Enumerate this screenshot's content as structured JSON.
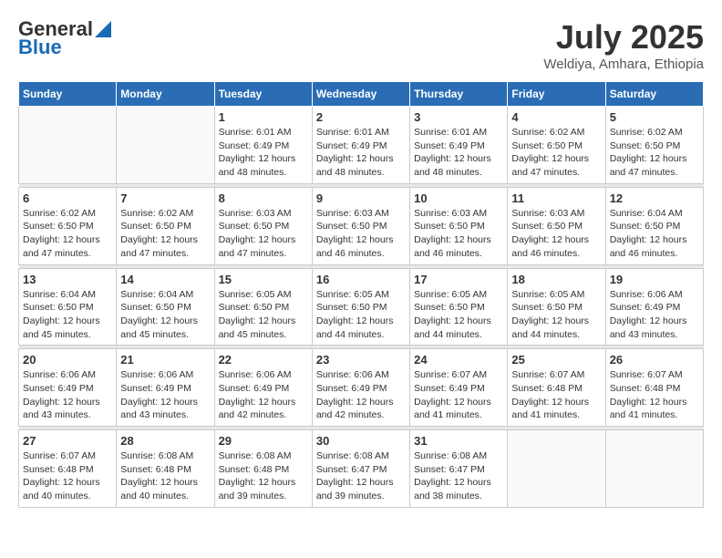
{
  "logo": {
    "general": "General",
    "blue": "Blue"
  },
  "title": "July 2025",
  "location": "Weldiya, Amhara, Ethiopia",
  "days_of_week": [
    "Sunday",
    "Monday",
    "Tuesday",
    "Wednesday",
    "Thursday",
    "Friday",
    "Saturday"
  ],
  "weeks": [
    [
      {
        "day": "",
        "info": ""
      },
      {
        "day": "",
        "info": ""
      },
      {
        "day": "1",
        "info": "Sunrise: 6:01 AM\nSunset: 6:49 PM\nDaylight: 12 hours and 48 minutes."
      },
      {
        "day": "2",
        "info": "Sunrise: 6:01 AM\nSunset: 6:49 PM\nDaylight: 12 hours and 48 minutes."
      },
      {
        "day": "3",
        "info": "Sunrise: 6:01 AM\nSunset: 6:49 PM\nDaylight: 12 hours and 48 minutes."
      },
      {
        "day": "4",
        "info": "Sunrise: 6:02 AM\nSunset: 6:50 PM\nDaylight: 12 hours and 47 minutes."
      },
      {
        "day": "5",
        "info": "Sunrise: 6:02 AM\nSunset: 6:50 PM\nDaylight: 12 hours and 47 minutes."
      }
    ],
    [
      {
        "day": "6",
        "info": "Sunrise: 6:02 AM\nSunset: 6:50 PM\nDaylight: 12 hours and 47 minutes."
      },
      {
        "day": "7",
        "info": "Sunrise: 6:02 AM\nSunset: 6:50 PM\nDaylight: 12 hours and 47 minutes."
      },
      {
        "day": "8",
        "info": "Sunrise: 6:03 AM\nSunset: 6:50 PM\nDaylight: 12 hours and 47 minutes."
      },
      {
        "day": "9",
        "info": "Sunrise: 6:03 AM\nSunset: 6:50 PM\nDaylight: 12 hours and 46 minutes."
      },
      {
        "day": "10",
        "info": "Sunrise: 6:03 AM\nSunset: 6:50 PM\nDaylight: 12 hours and 46 minutes."
      },
      {
        "day": "11",
        "info": "Sunrise: 6:03 AM\nSunset: 6:50 PM\nDaylight: 12 hours and 46 minutes."
      },
      {
        "day": "12",
        "info": "Sunrise: 6:04 AM\nSunset: 6:50 PM\nDaylight: 12 hours and 46 minutes."
      }
    ],
    [
      {
        "day": "13",
        "info": "Sunrise: 6:04 AM\nSunset: 6:50 PM\nDaylight: 12 hours and 45 minutes."
      },
      {
        "day": "14",
        "info": "Sunrise: 6:04 AM\nSunset: 6:50 PM\nDaylight: 12 hours and 45 minutes."
      },
      {
        "day": "15",
        "info": "Sunrise: 6:05 AM\nSunset: 6:50 PM\nDaylight: 12 hours and 45 minutes."
      },
      {
        "day": "16",
        "info": "Sunrise: 6:05 AM\nSunset: 6:50 PM\nDaylight: 12 hours and 44 minutes."
      },
      {
        "day": "17",
        "info": "Sunrise: 6:05 AM\nSunset: 6:50 PM\nDaylight: 12 hours and 44 minutes."
      },
      {
        "day": "18",
        "info": "Sunrise: 6:05 AM\nSunset: 6:50 PM\nDaylight: 12 hours and 44 minutes."
      },
      {
        "day": "19",
        "info": "Sunrise: 6:06 AM\nSunset: 6:49 PM\nDaylight: 12 hours and 43 minutes."
      }
    ],
    [
      {
        "day": "20",
        "info": "Sunrise: 6:06 AM\nSunset: 6:49 PM\nDaylight: 12 hours and 43 minutes."
      },
      {
        "day": "21",
        "info": "Sunrise: 6:06 AM\nSunset: 6:49 PM\nDaylight: 12 hours and 43 minutes."
      },
      {
        "day": "22",
        "info": "Sunrise: 6:06 AM\nSunset: 6:49 PM\nDaylight: 12 hours and 42 minutes."
      },
      {
        "day": "23",
        "info": "Sunrise: 6:06 AM\nSunset: 6:49 PM\nDaylight: 12 hours and 42 minutes."
      },
      {
        "day": "24",
        "info": "Sunrise: 6:07 AM\nSunset: 6:49 PM\nDaylight: 12 hours and 41 minutes."
      },
      {
        "day": "25",
        "info": "Sunrise: 6:07 AM\nSunset: 6:48 PM\nDaylight: 12 hours and 41 minutes."
      },
      {
        "day": "26",
        "info": "Sunrise: 6:07 AM\nSunset: 6:48 PM\nDaylight: 12 hours and 41 minutes."
      }
    ],
    [
      {
        "day": "27",
        "info": "Sunrise: 6:07 AM\nSunset: 6:48 PM\nDaylight: 12 hours and 40 minutes."
      },
      {
        "day": "28",
        "info": "Sunrise: 6:08 AM\nSunset: 6:48 PM\nDaylight: 12 hours and 40 minutes."
      },
      {
        "day": "29",
        "info": "Sunrise: 6:08 AM\nSunset: 6:48 PM\nDaylight: 12 hours and 39 minutes."
      },
      {
        "day": "30",
        "info": "Sunrise: 6:08 AM\nSunset: 6:47 PM\nDaylight: 12 hours and 39 minutes."
      },
      {
        "day": "31",
        "info": "Sunrise: 6:08 AM\nSunset: 6:47 PM\nDaylight: 12 hours and 38 minutes."
      },
      {
        "day": "",
        "info": ""
      },
      {
        "day": "",
        "info": ""
      }
    ]
  ]
}
